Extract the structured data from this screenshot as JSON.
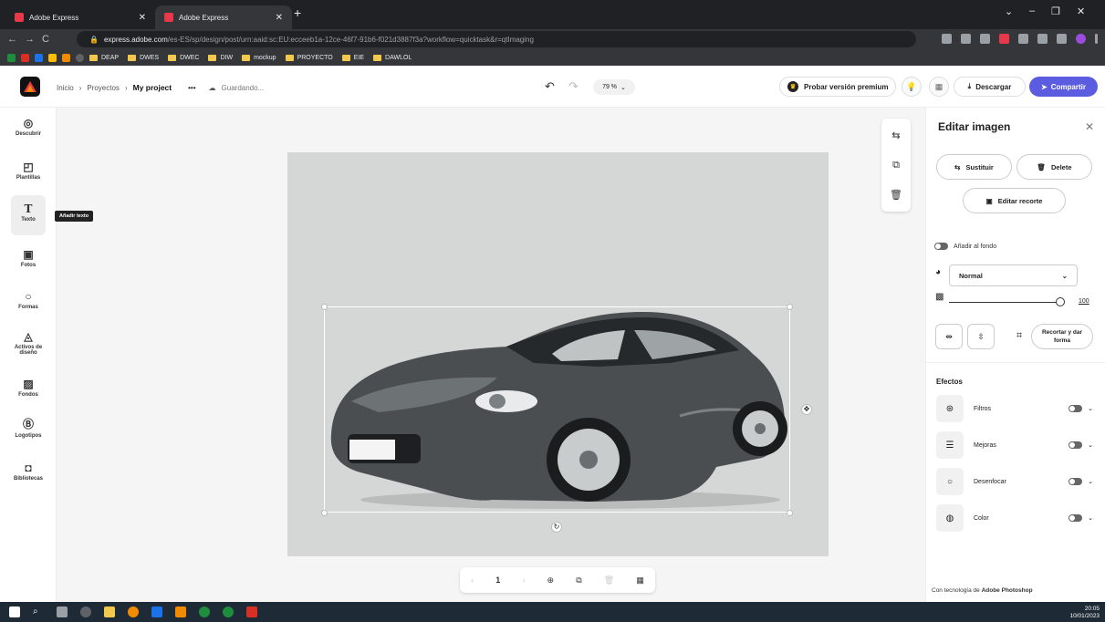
{
  "browser": {
    "tabs": [
      {
        "label": "Adobe Express"
      },
      {
        "label": "Adobe Express"
      }
    ],
    "url_domain": "express.adobe.com",
    "url_path": "/es-ES/sp/design/post/urn:aaid:sc:EU:ecceeb1a-12ce-46f7-91b6-f021d3887f3a?workflow=quicktask&r=qtImaging",
    "bookmarks": [
      "DEAP",
      "DWES",
      "DWEC",
      "DIW",
      "mockup",
      "PROYECTO",
      "EIE",
      "DAWLOL"
    ]
  },
  "appbar": {
    "breadcrumb_home": "Inicio",
    "breadcrumb_projects": "Proyectos",
    "project_name": "My project",
    "more": "•••",
    "saving": "Guardando...",
    "zoom": "79 %",
    "premium": "Probar versión premium",
    "download": "Descargar",
    "share": "Compartir"
  },
  "leftrail": {
    "items": [
      {
        "label": "Descubrir",
        "icon": "compass-icon"
      },
      {
        "label": "Plantillas",
        "icon": "templates-icon"
      },
      {
        "label": "Texto",
        "icon": "text-icon"
      },
      {
        "label": "Fotos",
        "icon": "photo-icon"
      },
      {
        "label": "Formas",
        "icon": "shapes-icon"
      },
      {
        "label": "Activos de diseño",
        "icon": "design-assets-icon"
      },
      {
        "label": "Fondos",
        "icon": "backgrounds-icon"
      },
      {
        "label": "Logotipos",
        "icon": "logos-icon"
      },
      {
        "label": "Bibliotecas",
        "icon": "libraries-icon"
      }
    ],
    "tooltip": "Añadir texto"
  },
  "pagebar": {
    "page_number": "1"
  },
  "panel": {
    "title": "Editar imagen",
    "replace": "Sustituir",
    "delete": "Delete",
    "edit_crop": "Editar recorte",
    "add_to_bg": "Añadir al fondo",
    "blend_mode": "Normal",
    "opacity": "100",
    "crop_shape": "Recortar y dar forma",
    "effects_title": "Efectos",
    "effects": [
      {
        "label": "Filtros"
      },
      {
        "label": "Mejoras"
      },
      {
        "label": "Desenfocar"
      },
      {
        "label": "Color"
      }
    ],
    "footer_prefix": "Con tecnología de",
    "footer_brand": "Adobe Photoshop"
  },
  "taskbar": {
    "time": "20:05",
    "date": "10/01/2023"
  },
  "colors": {
    "accent": "#5c5ce0",
    "canvas_bg": "#d5d7d6",
    "car_body": "#4a4e50"
  }
}
